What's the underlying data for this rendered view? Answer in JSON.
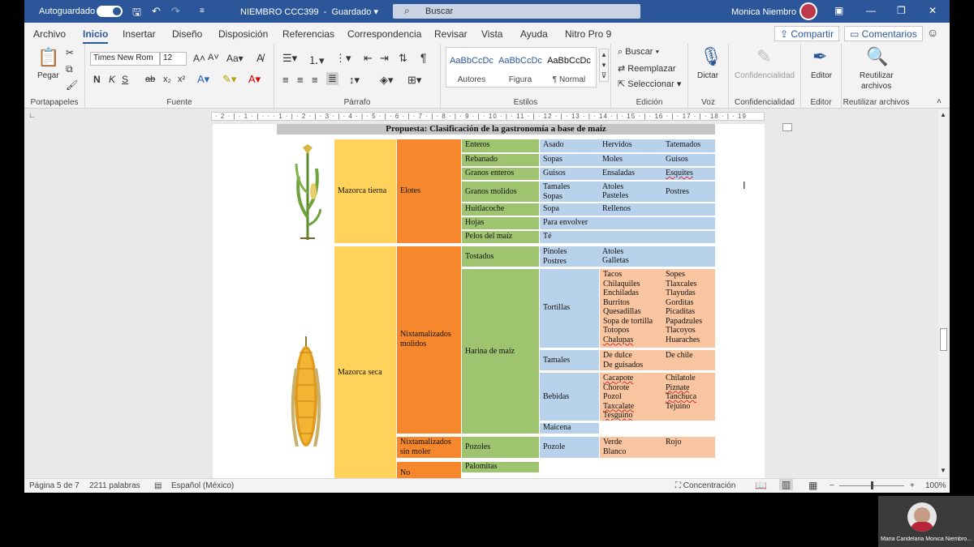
{
  "titlebar": {
    "autosave_label": "Autoguardado",
    "doc_name": "NIEMBRO CCC399",
    "save_status": "Guardado",
    "search_placeholder": "Buscar",
    "user_name": "Monica Niembro"
  },
  "menu": {
    "items": [
      "Archivo",
      "Inicio",
      "Insertar",
      "Diseño",
      "Disposición",
      "Referencias",
      "Correspondencia",
      "Revisar",
      "Vista",
      "Ayuda",
      "Nitro Pro 9"
    ],
    "share": "Compartir",
    "comments": "Comentarios"
  },
  "ribbon": {
    "clipboard": {
      "paste": "Pegar",
      "label": "Portapapeles"
    },
    "font": {
      "name": "Times New Rom",
      "size": "12",
      "label": "Fuente"
    },
    "paragraph": {
      "label": "Párrafo"
    },
    "styles": {
      "items": [
        {
          "preview": "AaBbCcDc",
          "name": "Autores"
        },
        {
          "preview": "AaBbCcDc",
          "name": "Figura"
        },
        {
          "preview": "AaBbCcDc",
          "name": "¶ Normal"
        }
      ],
      "label": "Estilos"
    },
    "editing": {
      "find": "Buscar",
      "replace": "Reemplazar",
      "select": "Seleccionar",
      "label": "Edición"
    },
    "voice": {
      "dictate": "Dictar",
      "label": "Voz"
    },
    "confidential": {
      "btn": "Confidencialidad",
      "label": "Confidencialidad"
    },
    "editor": {
      "btn": "Editor",
      "label": "Editor"
    },
    "reuse": {
      "btn1": "Reutilizar",
      "btn2": "archivos",
      "label": "Reutilizar archivos"
    }
  },
  "ruler": {
    "text": "· 2 · | · 1 · | · · · 1 · | · 2 · | · 3 · | · 4 · | · 5 · | · 6 · | · 7 · | · 8 · | · 9 · | · 10 · | · 11 · | · 12 · | · 13 · | · 14 · | · 15 · | · 16 · | · 17 · | · 18 · | · 19"
  },
  "doc": {
    "title": "Propuesta: Clasificación de la gastronomía a base de maíz",
    "fresh": "Mazorca tierna",
    "elotes": "Elotes",
    "f_parts": [
      "Enteros",
      "Rebanado",
      "Granos enteros",
      "Granos molidos",
      "Huitlacoche",
      "Hojas",
      "Pelos del maíz"
    ],
    "r1": [
      "Asado",
      "Hervidos",
      "Tatemados"
    ],
    "r2": [
      "Sopas",
      "Moles",
      "Guisos"
    ],
    "r3": [
      "Guisos",
      "Ensaladas",
      "Esquites"
    ],
    "r4": [
      "Tamales",
      "Sopas",
      "Atoles",
      "Pasteles",
      "Postres"
    ],
    "r5": [
      "Sopa",
      "Rellenos"
    ],
    "r6": "Para envolver",
    "r7": "Té",
    "dry": "Mazorca seca",
    "nix_molidos": "Nixtamalizados molidos",
    "tostados": "Tostados",
    "tost_a": [
      "Pinoles",
      "Postres"
    ],
    "tost_b": [
      "Atoles",
      "Galletas"
    ],
    "harina": "Harina de maíz",
    "tortillas": "Tortillas",
    "tort_a": [
      "Tacos",
      "Chilaquiles",
      "Enchiladas",
      "Burritos",
      "Quesadillas",
      "Sopa de tortilla",
      "Totopos",
      "Chalupas"
    ],
    "tort_b": [
      "Sopes",
      "Tlaxcales",
      "Tlayudas",
      "Gorditas",
      "Picaditas",
      "Papadzules",
      "Tlacoyos",
      "Huaraches"
    ],
    "tamales": "Tamales",
    "tam_a": [
      "De dulce",
      "De guisados"
    ],
    "tam_b": "De chile",
    "bebidas": "Bebidas",
    "beb_a": [
      "Cacapote",
      "Chorote",
      "Pozol",
      "Taxcalate",
      "Tesguino"
    ],
    "beb_b": [
      "Chilatole",
      "Piznate",
      "Tanchuca",
      "Tejuino"
    ],
    "maicena": "Maicena",
    "nix_sin": "Nixtamalizados sin moler",
    "pozoles": "Pozoles",
    "pozole": "Pozole",
    "poz_a": [
      "Verde",
      "Blanco"
    ],
    "poz_b": "Rojo",
    "no": "No",
    "palomitas": "Palomitas"
  },
  "status": {
    "page": "Página 5 de 7",
    "words": "2211 palabras",
    "lang": "Español (México)",
    "focus": "Concentración",
    "zoom": "100%"
  },
  "webcam": {
    "name": "Maria Candelaria Monica Niembro..."
  }
}
